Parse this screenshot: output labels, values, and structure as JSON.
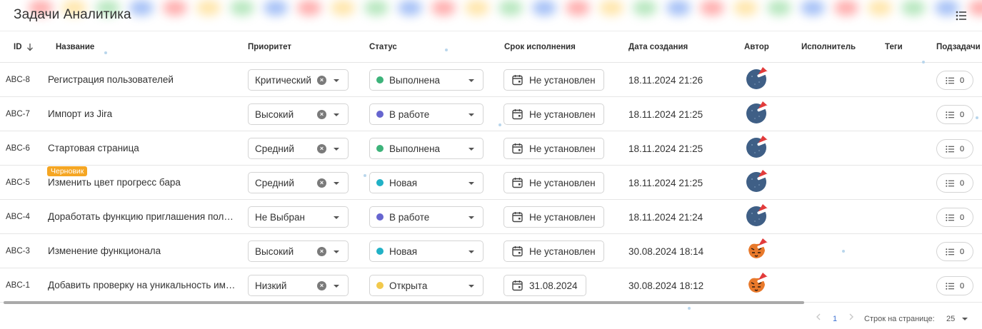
{
  "header": {
    "title": "Задачи Аналитика",
    "view_icon": "list-settings-icon"
  },
  "columns": {
    "id": "ID",
    "name": "Название",
    "priority": "Приоритет",
    "status": "Статус",
    "due": "Срок исполнения",
    "created": "Дата создания",
    "author": "Автор",
    "assignee": "Исполнитель",
    "tags": "Теги",
    "subtasks": "Подзадачи"
  },
  "colors": {
    "status_done": "#3db37a",
    "status_in_progress": "#6665cf",
    "status_new": "#21b1c6",
    "status_open": "#f2c94c",
    "draft_badge": "#f5a623"
  },
  "rows": [
    {
      "id": "ABC-8",
      "name": "Регистрация пользователей",
      "priority": "Критический",
      "priority_clearable": true,
      "status": "Выполнена",
      "status_color": "#3db37a",
      "due": "Не установлен",
      "created": "18.11.2024 21:26",
      "author_avatar": "blue",
      "subtasks": "0",
      "draft": ""
    },
    {
      "id": "ABC-7",
      "name": "Импорт из Jira",
      "priority": "Высокий",
      "priority_clearable": true,
      "status": "В работе",
      "status_color": "#6665cf",
      "due": "Не установлен",
      "created": "18.11.2024 21:25",
      "author_avatar": "blue",
      "subtasks": "0",
      "draft": ""
    },
    {
      "id": "ABC-6",
      "name": "Стартовая страница",
      "priority": "Средний",
      "priority_clearable": true,
      "status": "Выполнена",
      "status_color": "#3db37a",
      "due": "Не установлен",
      "created": "18.11.2024 21:25",
      "author_avatar": "blue",
      "subtasks": "0",
      "draft": ""
    },
    {
      "id": "ABC-5",
      "name": "Изменить цвет прогресс бара",
      "priority": "Средний",
      "priority_clearable": true,
      "status": "Новая",
      "status_color": "#21b1c6",
      "due": "Не установлен",
      "created": "18.11.2024 21:25",
      "author_avatar": "blue",
      "subtasks": "0",
      "draft": "Черновик"
    },
    {
      "id": "ABC-4",
      "name": "Доработать функцию приглашения пользователей",
      "priority": "Не Выбран",
      "priority_clearable": false,
      "status": "В работе",
      "status_color": "#6665cf",
      "due": "Не установлен",
      "created": "18.11.2024 21:24",
      "author_avatar": "blue",
      "subtasks": "0",
      "draft": ""
    },
    {
      "id": "ABC-3",
      "name": "Изменение функционала",
      "priority": "Высокий",
      "priority_clearable": true,
      "status": "Новая",
      "status_color": "#21b1c6",
      "due": "Не установлен",
      "created": "30.08.2024 18:14",
      "author_avatar": "tiger",
      "subtasks": "0",
      "draft": ""
    },
    {
      "id": "ABC-1",
      "name": "Добавить проверку на уникальность имени",
      "priority": "Низкий",
      "priority_clearable": true,
      "status": "Открыта",
      "status_color": "#f2c94c",
      "due": "31.08.2024",
      "created": "30.08.2024 18:12",
      "author_avatar": "tiger",
      "subtasks": "0",
      "draft": ""
    }
  ],
  "pagination": {
    "prev_icon": "chevron-left-icon",
    "page": "1",
    "next_icon": "chevron-right-icon",
    "rows_per_page_label": "Строк на странице:",
    "rows_per_page": "25"
  }
}
